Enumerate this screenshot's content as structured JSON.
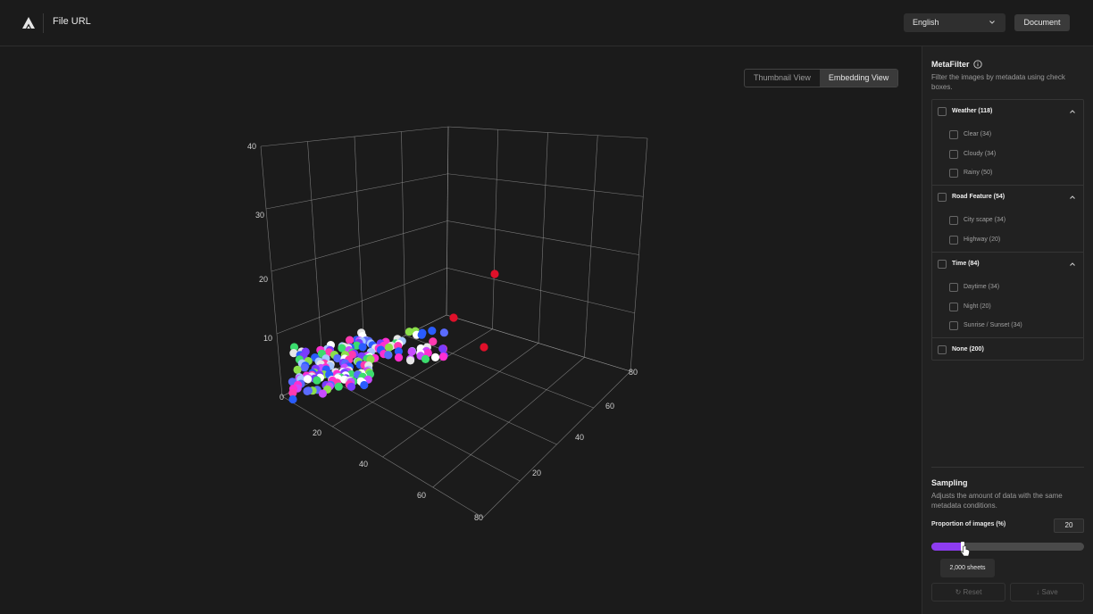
{
  "header": {
    "app_title": "File URL",
    "language": "English",
    "document_label": "Document"
  },
  "view_toggle": {
    "options": [
      "Thumbnail View",
      "Embedding View"
    ],
    "active": "Embedding View"
  },
  "chart_data": {
    "type": "scatter",
    "dimensions": 3,
    "z_ticks": [
      "0",
      "10",
      "20",
      "30",
      "40"
    ],
    "x_ticks": [
      "20",
      "40",
      "60",
      "80"
    ],
    "y_ticks": [
      "20",
      "40",
      "60",
      "80"
    ],
    "zlim": [
      0,
      40
    ],
    "xlim": [
      0,
      80
    ],
    "ylim": [
      0,
      80
    ],
    "grid": true,
    "legend": "none",
    "colors": [
      "#e6e6e6",
      "#a8c8ff",
      "#3cdc6e",
      "#8be04a",
      "#2a5cff",
      "#5a6bff",
      "#7a3cff",
      "#ff2fd1",
      "#ff3ab0",
      "#c84cff",
      "#ffffff",
      "#e0102a"
    ],
    "highlight_color": "#e0102a",
    "point_count": 200
  },
  "metafilter": {
    "title": "MetaFilter",
    "description": "Filter the images by metadata using check boxes.",
    "groups": [
      {
        "label": "Weather (118)",
        "items": [
          "Clear (34)",
          "Cloudy (34)",
          "Rainy (50)"
        ]
      },
      {
        "label": "Road Feature (54)",
        "items": [
          "City scape (34)",
          "Highway (20)"
        ]
      },
      {
        "label": "Time (84)",
        "items": [
          "Daytime (34)",
          "Night (20)",
          "Sunrise / Sunset (34)"
        ]
      },
      {
        "label": "None (200)",
        "items": []
      }
    ]
  },
  "sampling": {
    "title": "Sampling",
    "description": "Adjusts the amount of data with the same metadata conditions.",
    "proportion_label": "Proportion of images (%)",
    "proportion_value": "20",
    "slider_fraction": 0.2,
    "tooltip": "2,000 sheets",
    "reset_label": "Reset",
    "save_label": "Save",
    "accent_color": "#8d3cf0"
  }
}
